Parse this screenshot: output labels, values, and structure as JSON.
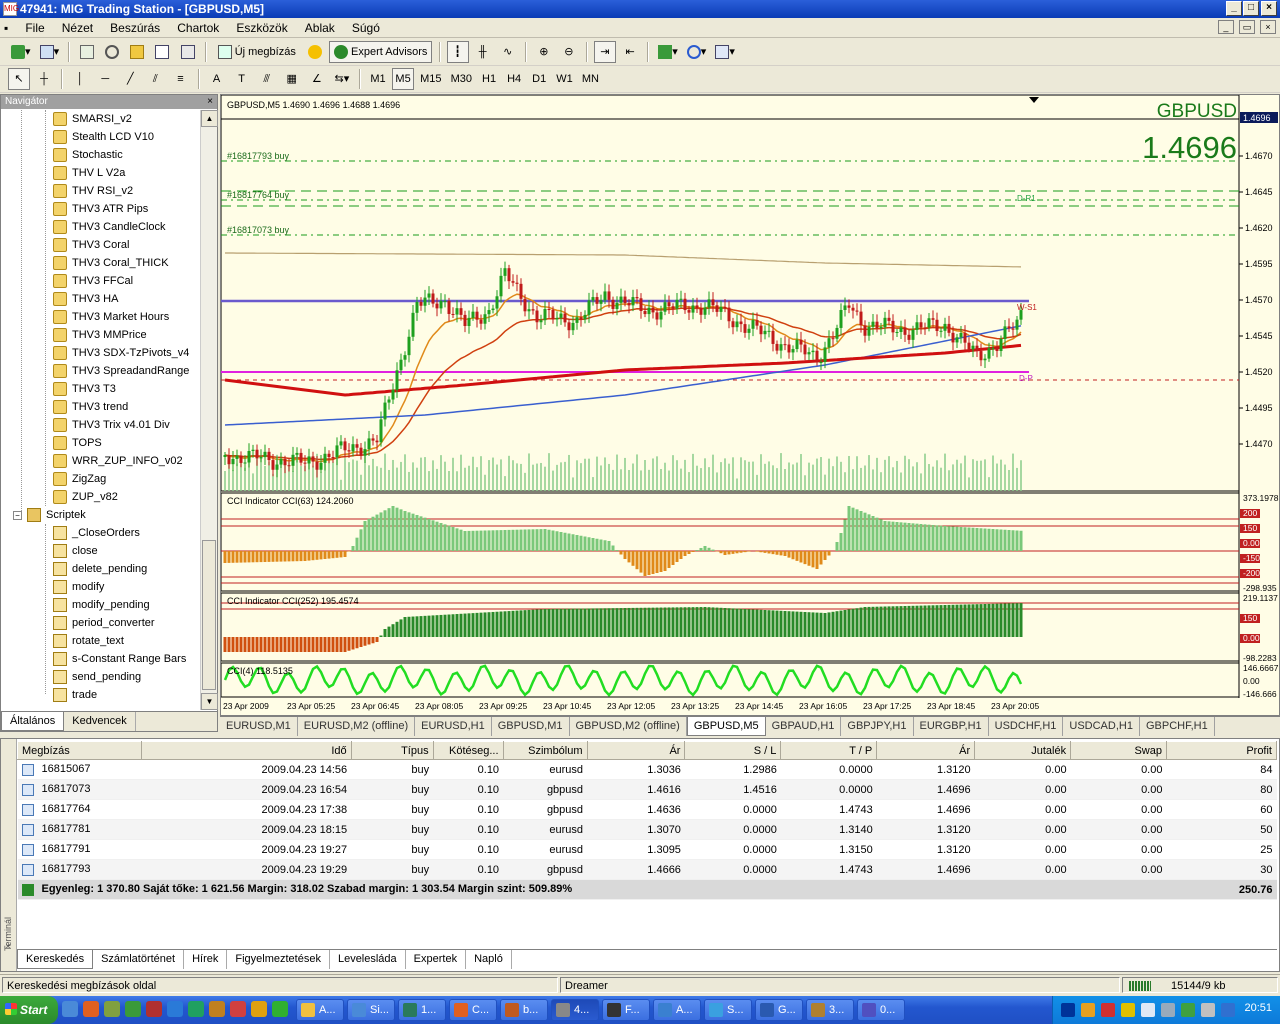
{
  "window": {
    "title": "47941: MIG Trading Station - [GBPUSD,M5]",
    "app_icon": "MIG"
  },
  "menu": [
    "File",
    "Nézet",
    "Beszúrás",
    "Chartok",
    "Eszközök",
    "Ablak",
    "Súgó"
  ],
  "toolbar1": {
    "new_order_label": "Új megbízás",
    "expert_advisors_label": "Expert Advisors"
  },
  "toolbar2": {
    "timeframes": [
      "M1",
      "M5",
      "M15",
      "M30",
      "H1",
      "H4",
      "D1",
      "W1",
      "MN"
    ],
    "active_timeframe": "M5"
  },
  "navigator": {
    "title": "Navigátor",
    "indicators": [
      "SMARSI_v2",
      "Stealth LCD V10",
      "Stochastic",
      "THV L V2a",
      "THV RSI_v2",
      "THV3 ATR Pips",
      "THV3 CandleClock",
      "THV3 Coral",
      "THV3 Coral_THICK",
      "THV3 FFCal",
      "THV3 HA",
      "THV3 Market Hours",
      "THV3 MMPrice",
      "THV3 SDX-TzPivots_v4",
      "THV3 SpreadandRange",
      "THV3 T3",
      "THV3 trend",
      "THV3 Trix v4.01 Div",
      "TOPS",
      "WRR_ZUP_INFO_v02",
      "ZigZag",
      "ZUP_v82"
    ],
    "scripts_folder": "Scriptek",
    "scripts": [
      "_CloseOrders",
      "close",
      "delete_pending",
      "modify",
      "modify_pending",
      "period_converter",
      "rotate_text",
      "s-Constant Range Bars",
      "send_pending",
      "trade"
    ],
    "tabs": [
      "Általános",
      "Kedvencek"
    ],
    "active_tab": "Általános"
  },
  "chart": {
    "header": "GBPUSD,M5  1.4690 1.4696 1.4688 1.4696",
    "symbol": "GBPUSD",
    "big_price": "1.4696",
    "current_price_tag": "1.4696",
    "order_lines": [
      "#16817793 buy",
      "#16817764 buy",
      "#16817073 buy"
    ],
    "pivot_labels": [
      "D-R1",
      "W-S1",
      "D-P"
    ],
    "price_axis": [
      "1.4670",
      "1.4645",
      "1.4620",
      "1.4595",
      "1.4570",
      "1.4545",
      "1.4520",
      "1.4495",
      "1.4470"
    ],
    "time_axis": [
      "23 Apr 2009",
      "23 Apr 05:25",
      "23 Apr 06:45",
      "23 Apr 08:05",
      "23 Apr 09:25",
      "23 Apr 10:45",
      "23 Apr 12:05",
      "23 Apr 13:25",
      "23 Apr 14:45",
      "23 Apr 16:05",
      "23 Apr 17:25",
      "23 Apr 18:45",
      "23 Apr 20:05"
    ],
    "cci1": {
      "label": "CCI Indicator  CCI(63) 124.2060",
      "axis": [
        "373.1978",
        "200",
        "150",
        "0.00",
        "-150",
        "-200",
        "-298.935"
      ]
    },
    "cci2": {
      "label": "CCI Indicator  CCI(252) 195.4574",
      "axis": [
        "219.1137",
        "150",
        "0.00",
        "-98.2283"
      ]
    },
    "cci3": {
      "label": "CCI(4) 118.5135",
      "axis": [
        "146.6667",
        "0.00",
        "-146.666"
      ]
    },
    "colors": {
      "background": "#fffde6",
      "bull": "#1ea01e",
      "bear": "#c01a1a",
      "ema_fast": "#e08a1a",
      "ema_slow": "#d04010",
      "sma_blue": "#3a5fcf",
      "sma_red": "#d01010",
      "pivot_line": "#6a5acd",
      "magenta_line": "#e020e0",
      "cci3": "#22dd22"
    }
  },
  "chart_tabs": [
    "EURUSD,M1",
    "EURUSD,M2 (offline)",
    "EURUSD,H1",
    "GBPUSD,M1",
    "GBPUSD,M2 (offline)",
    "GBPUSD,M5",
    "GBPAUD,H1",
    "GBPJPY,H1",
    "EURGBP,H1",
    "USDCHF,H1",
    "USDCAD,H1",
    "GBPCHF,H1"
  ],
  "active_chart_tab": "GBPUSD,M5",
  "terminal": {
    "side_label": "Terminál",
    "columns": [
      "Megbízás",
      "Idő",
      "Típus",
      "Kötéseg...",
      "Szimbólum",
      "Ár",
      "S / L",
      "T / P",
      "Ár",
      "Jutalék",
      "Swap",
      "Profit"
    ],
    "rows": [
      [
        "16815067",
        "2009.04.23 14:56",
        "buy",
        "0.10",
        "eurusd",
        "1.3036",
        "1.2986",
        "0.0000",
        "1.3120",
        "0.00",
        "0.00",
        "84"
      ],
      [
        "16817073",
        "2009.04.23 16:54",
        "buy",
        "0.10",
        "gbpusd",
        "1.4616",
        "1.4516",
        "0.0000",
        "1.4696",
        "0.00",
        "0.00",
        "80"
      ],
      [
        "16817764",
        "2009.04.23 17:38",
        "buy",
        "0.10",
        "gbpusd",
        "1.4636",
        "0.0000",
        "1.4743",
        "1.4696",
        "0.00",
        "0.00",
        "60"
      ],
      [
        "16817781",
        "2009.04.23 18:15",
        "buy",
        "0.10",
        "eurusd",
        "1.3070",
        "0.0000",
        "1.3140",
        "1.3120",
        "0.00",
        "0.00",
        "50"
      ],
      [
        "16817791",
        "2009.04.23 19:27",
        "buy",
        "0.10",
        "eurusd",
        "1.3095",
        "0.0000",
        "1.3150",
        "1.3120",
        "0.00",
        "0.00",
        "25"
      ],
      [
        "16817793",
        "2009.04.23 19:29",
        "buy",
        "0.10",
        "gbpusd",
        "1.4666",
        "0.0000",
        "1.4743",
        "1.4696",
        "0.00",
        "0.00",
        "30"
      ]
    ],
    "summary": "Egyenleg: 1 370.80  Saját tőke: 1 621.56  Margin: 318.02  Szabad margin: 1 303.54  Margin szint: 509.89%",
    "summary_profit": "250.76",
    "tabs": [
      "Kereskedés",
      "Számlatörténet",
      "Hírek",
      "Figyelmeztetések",
      "Levelesláda",
      "Expertek",
      "Napló"
    ],
    "active_tab": "Kereskedés"
  },
  "status": {
    "left": "Kereskedési megbízások oldal",
    "profile": "Dreamer",
    "traffic": "15144/9 kb"
  },
  "taskbar": {
    "start": "Start",
    "tasks": [
      "A...",
      "Si...",
      "1...",
      "C...",
      "b...",
      "4...",
      "F...",
      "A...",
      "S...",
      "G...",
      "3...",
      "0..."
    ],
    "clock": "20:51"
  }
}
